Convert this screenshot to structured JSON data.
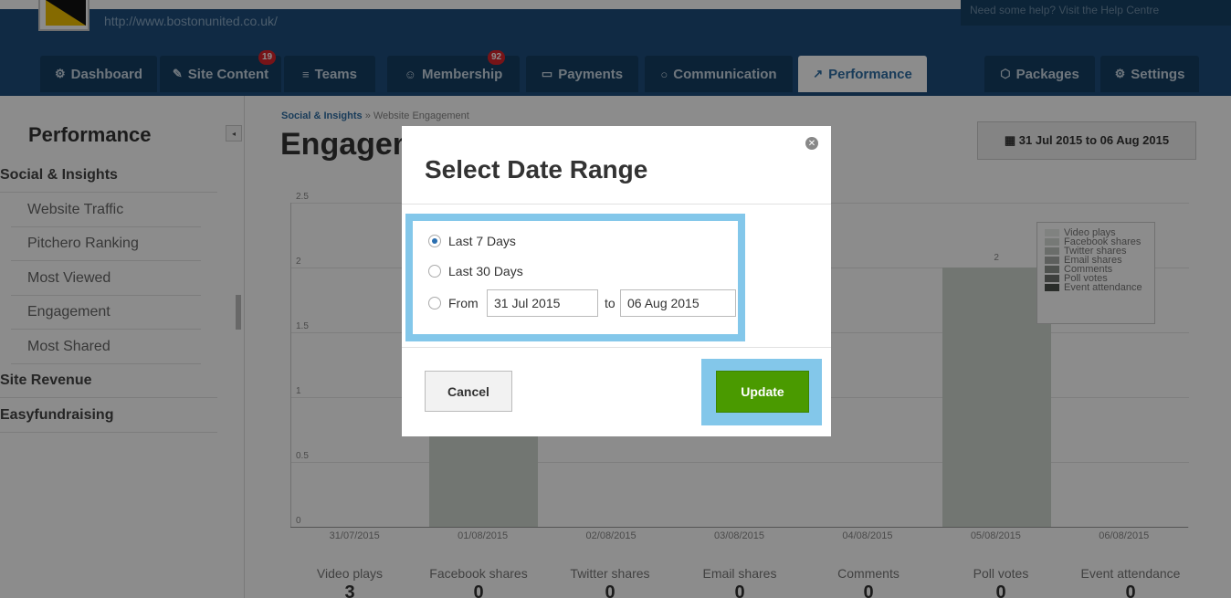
{
  "header": {
    "site_url": "http://www.bostonunited.co.uk/",
    "help_text": "Need some help? Visit the Help Centre"
  },
  "nav": {
    "tabs": [
      {
        "label": "Dashboard",
        "icon": "dashboard-icon",
        "glyph": "⚙"
      },
      {
        "label": "Site Content",
        "icon": "pencil-icon",
        "glyph": "✎",
        "badge": "19"
      },
      {
        "label": "Teams",
        "icon": "menu-icon",
        "glyph": "≡"
      },
      {
        "label": "Membership",
        "icon": "users-icon",
        "glyph": "☺",
        "badge": "92"
      },
      {
        "label": "Payments",
        "icon": "card-icon",
        "glyph": "▭"
      },
      {
        "label": "Communication",
        "icon": "chat-icon",
        "glyph": "○"
      },
      {
        "label": "Performance",
        "icon": "chart-icon",
        "glyph": "↗"
      },
      {
        "label": "Packages",
        "icon": "box-icon",
        "glyph": "⬡"
      },
      {
        "label": "Settings",
        "icon": "gear-icon",
        "glyph": "⚙"
      }
    ]
  },
  "sidebar": {
    "title": "Performance",
    "collapse_glyph": "◂",
    "items": [
      {
        "label": "Social & Insights",
        "section": true
      },
      {
        "label": "Website Traffic"
      },
      {
        "label": "Pitchero Ranking"
      },
      {
        "label": "Most Viewed"
      },
      {
        "label": "Engagement"
      },
      {
        "label": "Most Shared"
      },
      {
        "label": "Site Revenue",
        "section": true
      },
      {
        "label": "Easyfundraising",
        "section": true
      }
    ]
  },
  "main": {
    "breadcrumb_root": "Social & Insights",
    "breadcrumb_sep": " » ",
    "breadcrumb_current": "Website Engagement",
    "title": "Engagement",
    "date_range_label": "▦ 31 Jul 2015 to 06 Aug 2015"
  },
  "chart_data": {
    "type": "bar",
    "categories": [
      "31/07/2015",
      "01/08/2015",
      "02/08/2015",
      "03/08/2015",
      "04/08/2015",
      "05/08/2015",
      "06/08/2015"
    ],
    "ylim": [
      0,
      2.5
    ],
    "yticks": [
      "0",
      "0.5",
      "1",
      "1.5",
      "2",
      "2.5"
    ],
    "series": [
      {
        "name": "Video plays",
        "values": [
          0,
          1,
          0,
          0,
          0,
          2,
          0
        ]
      },
      {
        "name": "Facebook shares",
        "values": [
          0,
          0,
          0,
          0,
          0,
          0,
          0
        ]
      },
      {
        "name": "Twitter shares",
        "values": [
          0,
          0,
          0,
          0,
          0,
          0,
          0
        ]
      },
      {
        "name": "Email shares",
        "values": [
          0,
          0,
          0,
          0,
          0,
          0,
          0
        ]
      },
      {
        "name": "Comments",
        "values": [
          0,
          0,
          0,
          0,
          0,
          0,
          0
        ]
      },
      {
        "name": "Poll votes",
        "values": [
          0,
          0,
          0,
          0,
          0,
          0,
          0
        ]
      },
      {
        "name": "Event attendance",
        "values": [
          0,
          0,
          0,
          0,
          0,
          0,
          0
        ]
      }
    ],
    "data_labels": [
      {
        "category": "05/08/2015",
        "text": "2"
      }
    ],
    "legend_colors": [
      "#e9ede9",
      "#d7dcd7",
      "#c2c7c2",
      "#a9aea9",
      "#8f948f",
      "#6f746f",
      "#4d524d"
    ],
    "legend_position": "top-right"
  },
  "stats": [
    {
      "label": "Video plays",
      "value": "3"
    },
    {
      "label": "Facebook shares",
      "value": "0"
    },
    {
      "label": "Twitter shares",
      "value": "0"
    },
    {
      "label": "Email shares",
      "value": "0"
    },
    {
      "label": "Comments",
      "value": "0"
    },
    {
      "label": "Poll votes",
      "value": "0"
    },
    {
      "label": "Event attendance",
      "value": "0"
    }
  ],
  "modal": {
    "title": "Select Date Range",
    "close_glyph": "✕",
    "options": [
      {
        "label": "Last 7 Days",
        "checked": true
      },
      {
        "label": "Last 30 Days",
        "checked": false
      },
      {
        "label": "From",
        "checked": false
      }
    ],
    "from_value": "31 Jul 2015",
    "to_label": "to",
    "to_value": "06 Aug 2015",
    "cancel_label": "Cancel",
    "update_label": "Update"
  },
  "colors": {
    "header_bg": "#1e4e7c",
    "tab_bg": "#143e63",
    "accent": "#2e6da4",
    "highlight": "#83c7ea",
    "update_green": "#4a9a00",
    "badge_red": "#d9262c"
  }
}
